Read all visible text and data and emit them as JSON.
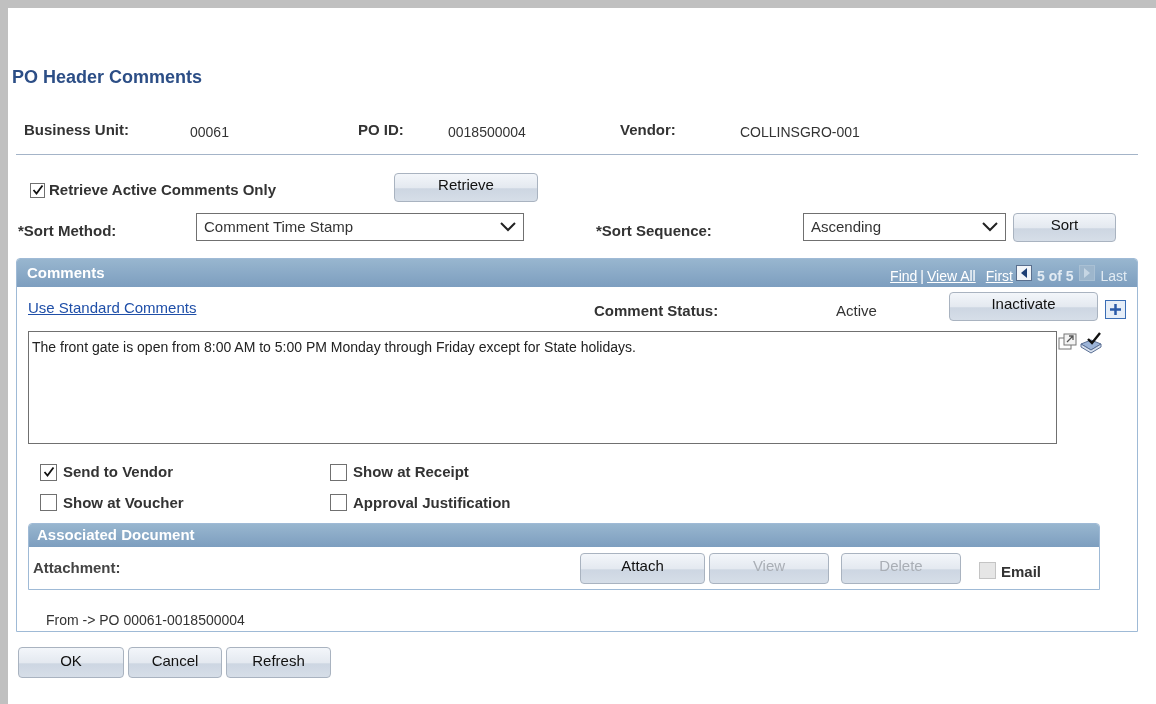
{
  "title": "PO Header Comments",
  "header_fields": [
    {
      "label": "Business Unit:",
      "value": "00061"
    },
    {
      "label": "PO ID:",
      "value": "0018500004"
    },
    {
      "label": "Vendor:",
      "value": "COLLINSGRO-001"
    }
  ],
  "retrieve_active": {
    "label": "Retrieve Active Comments Only",
    "checked": true
  },
  "retrieve_button": "Retrieve",
  "sort_method": {
    "label": "*Sort Method:",
    "value": "Comment Time Stamp"
  },
  "sort_sequence": {
    "label": "*Sort Sequence:",
    "value": "Ascending"
  },
  "sort_button": "Sort",
  "comments": {
    "title": "Comments",
    "nav": {
      "find": "Find",
      "separator": "|",
      "view_all": "View All",
      "first": "First",
      "prev_disabled": false,
      "count": "5 of 5",
      "next_disabled": true,
      "last": "Last",
      "last_disabled": true
    },
    "standard_comments_link": "Use Standard Comments",
    "status_label": "Comment Status:",
    "status_value": "Active",
    "inactivate_button": "Inactivate",
    "comment_text": "The front gate is open from 8:00 AM to 5:00 PM Monday through Friday except for State holidays.",
    "options": [
      {
        "label": "Send to Vendor",
        "checked": true
      },
      {
        "label": "Show at Receipt",
        "checked": false
      },
      {
        "label": "Show at Voucher",
        "checked": false
      },
      {
        "label": "Approval Justification",
        "checked": false
      }
    ],
    "associated_document": {
      "title": "Associated Document",
      "attachment_label": "Attachment:",
      "buttons": [
        {
          "label": "Attach",
          "disabled": false
        },
        {
          "label": "View",
          "disabled": true
        },
        {
          "label": "Delete",
          "disabled": true
        }
      ],
      "email": {
        "label": "Email",
        "checked": false,
        "disabled": true
      }
    },
    "source_text": "From -> PO 00061-0018500004"
  },
  "footer_buttons": [
    "OK",
    "Cancel",
    "Refresh"
  ]
}
